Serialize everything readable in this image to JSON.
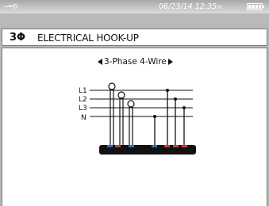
{
  "status_bar": {
    "date": "06/23/14",
    "time": "12:35",
    "time_suffix": "m"
  },
  "header": {
    "mode": "3Φ",
    "title": "ELECTRICAL HOOK-UP"
  },
  "selector": {
    "label": "3-Phase 4-Wire"
  },
  "diagram": {
    "lines": [
      "L1",
      "L2",
      "L3",
      "N"
    ],
    "colors": {
      "red": "#d23a3a",
      "blue": "#3a68c8",
      "base": "#111111"
    }
  }
}
